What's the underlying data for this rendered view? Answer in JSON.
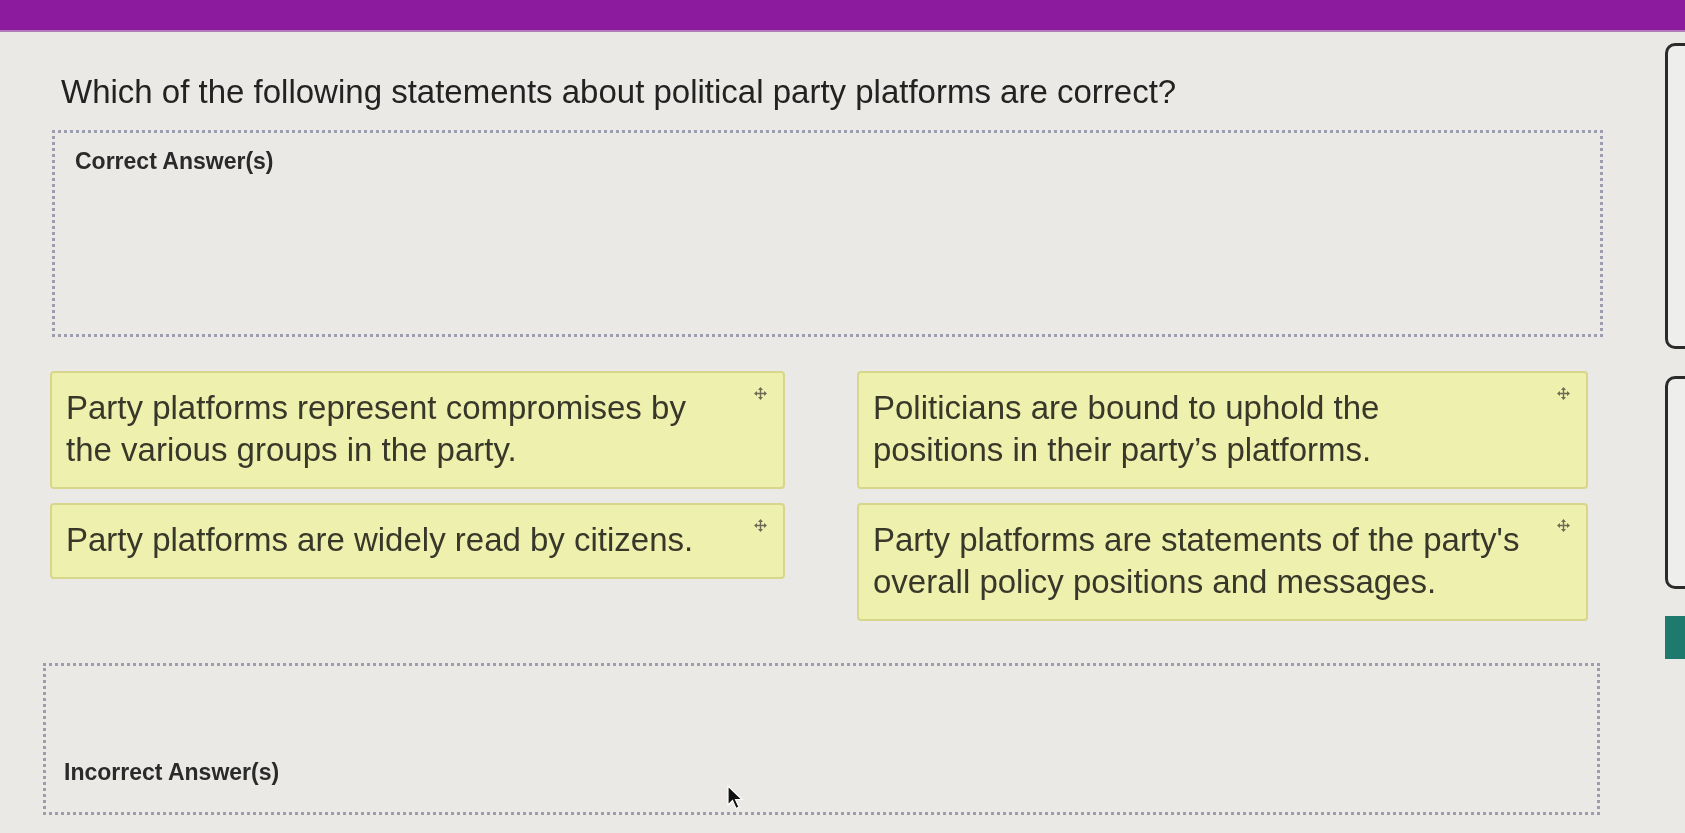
{
  "question": "Which of the following statements about political party platforms are correct?",
  "correct_zone": {
    "label": "Correct Answer(s)"
  },
  "answer_cards": [
    {
      "text": "Party platforms represent compromises by\nthe various groups in the party."
    },
    {
      "text": "Politicians are bound to uphold the\npositions in their party’s platforms."
    },
    {
      "text": "Party platforms are widely read by citizens."
    },
    {
      "text": "Party platforms are statements of the party's\noverall policy positions and messages."
    }
  ],
  "incorrect_zone": {
    "label": "Incorrect Answer(s)"
  }
}
